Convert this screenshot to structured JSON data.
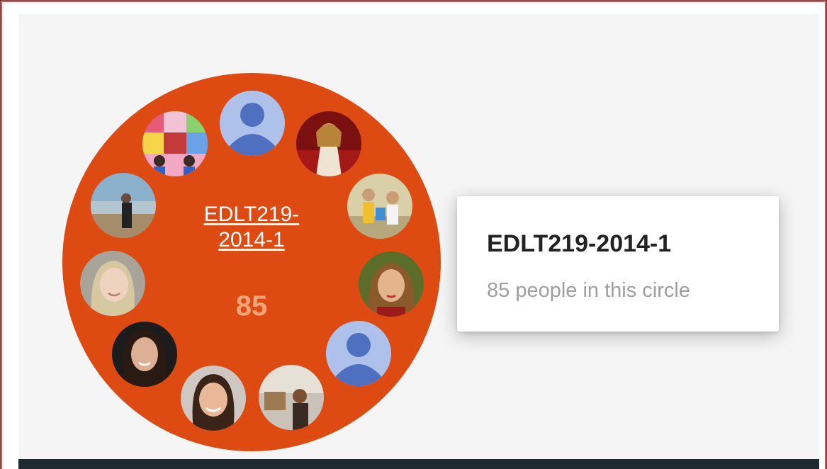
{
  "circle": {
    "name_line1": "EDLT219-",
    "name_line2": "2014-1",
    "member_count": "85",
    "color": "#dd4a12",
    "members": [
      {
        "kind": "default-avatar"
      },
      {
        "kind": "photo"
      },
      {
        "kind": "photo"
      },
      {
        "kind": "photo"
      },
      {
        "kind": "default-avatar"
      },
      {
        "kind": "photo"
      },
      {
        "kind": "photo"
      },
      {
        "kind": "photo"
      },
      {
        "kind": "photo"
      },
      {
        "kind": "photo"
      },
      {
        "kind": "photo"
      }
    ]
  },
  "hovercard": {
    "title": "EDLT219-2014-1",
    "subtitle": "85 people in this circle"
  }
}
